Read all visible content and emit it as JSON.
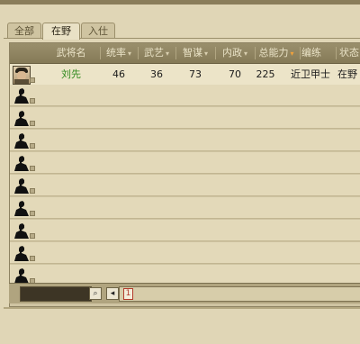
{
  "tabs": [
    {
      "label": "全部",
      "active": false
    },
    {
      "label": "在野",
      "active": true
    },
    {
      "label": "入仕",
      "active": false
    }
  ],
  "table": {
    "columns": [
      {
        "label": "武将名",
        "arrow": ""
      },
      {
        "label": "统率",
        "arrow": "▾"
      },
      {
        "label": "武艺",
        "arrow": "▾"
      },
      {
        "label": "智谋",
        "arrow": "▾"
      },
      {
        "label": "内政",
        "arrow": "▾"
      },
      {
        "label": "总能力",
        "arrow": "▾"
      },
      {
        "label": "编练",
        "arrow": ""
      },
      {
        "label": "状态",
        "arrow": ""
      }
    ],
    "rows": [
      {
        "name": "刘先",
        "command": "46",
        "martial": "36",
        "intellect": "73",
        "politics": "70",
        "total": "225",
        "training": "近卫甲士",
        "status": "在野"
      }
    ],
    "empty_rows": 9
  },
  "pagination": {
    "current_page": "1",
    "first_icon": "first-page-icon",
    "search_icon": "search-icon"
  },
  "colors": {
    "name_green": "#2f8a1d",
    "sorted_arrow": "#f2a23b",
    "page_red": "#b23b2b"
  }
}
